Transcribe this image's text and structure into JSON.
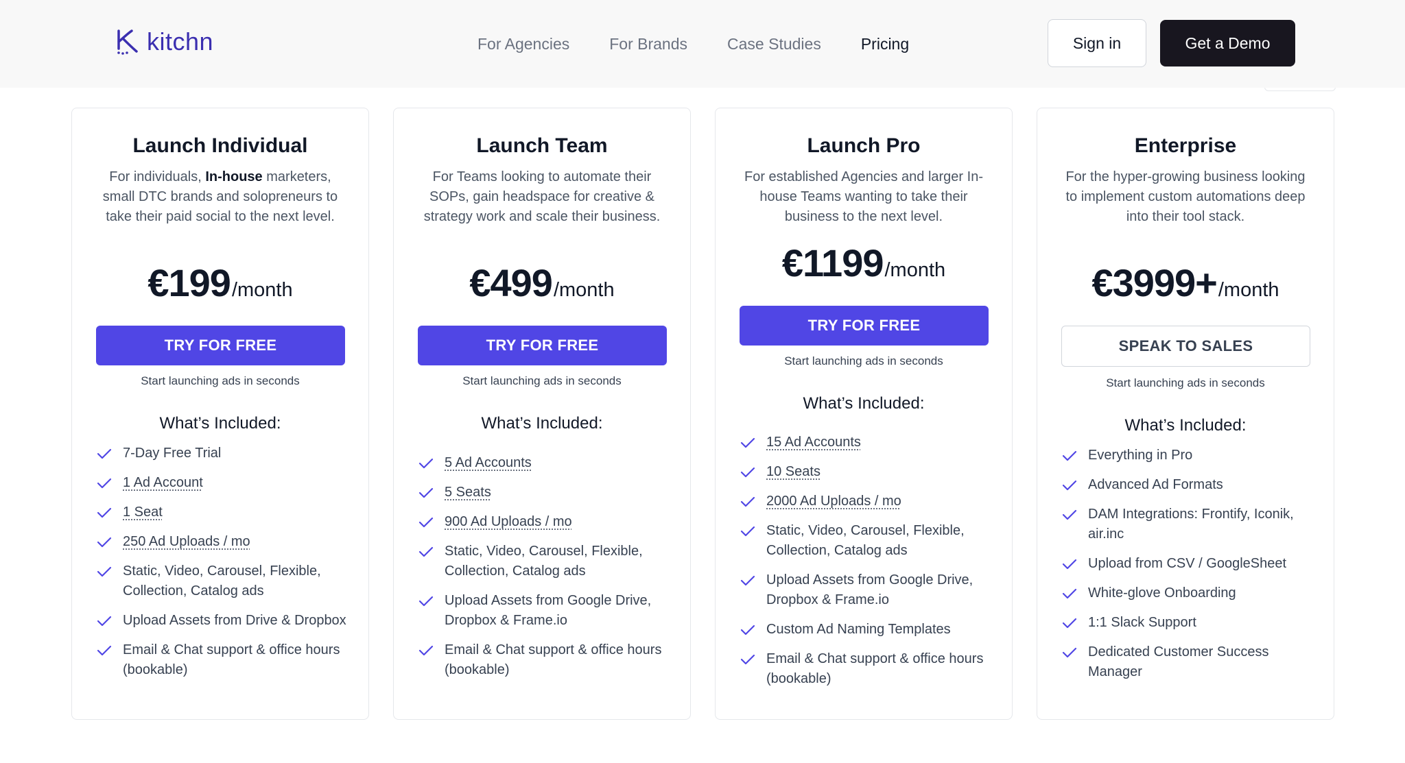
{
  "header": {
    "logo_text": "kitchn",
    "nav": [
      "For Agencies",
      "For Brands",
      "Case Studies",
      "Pricing"
    ],
    "sign_in": "Sign in",
    "get_demo": "Get a Demo"
  },
  "colors": {
    "accent": "#5046e5",
    "dark_button": "#18161f",
    "logo": "#3b2fb0"
  },
  "plans": [
    {
      "title": "Launch Individual",
      "desc_before": "For individuals, ",
      "desc_bold": "In-house",
      "desc_after": " marketers, small DTC brands and solopreneurs to take their paid social to the next level.",
      "price": "€199",
      "per": "/month",
      "cta": "TRY FOR FREE",
      "sub": "Start launching ads in seconds",
      "included": "What’s Included:",
      "features": [
        {
          "text": "7-Day Free Trial",
          "underline": false
        },
        {
          "text": "1 Ad Account",
          "underline": true
        },
        {
          "text": "1 Seat",
          "underline": true
        },
        {
          "text": "250 Ad Uploads / mo",
          "underline": true
        },
        {
          "text": "Static, Video, Carousel, Flexible, Collection, Catalog ads",
          "underline": false
        },
        {
          "text": "Upload Assets from Drive & Dropbox",
          "underline": false
        },
        {
          "text": "Email & Chat support & office hours (bookable)",
          "underline": false
        }
      ]
    },
    {
      "title": "Launch Team",
      "desc_before": "For Teams looking to automate their SOPs, gain headspace for creative & strategy work and scale their business.",
      "desc_bold": "",
      "desc_after": "",
      "price": "€499",
      "per": "/month",
      "cta": "TRY FOR FREE",
      "sub": "Start launching ads in seconds",
      "included": "What’s Included:",
      "features": [
        {
          "text": "5 Ad Accounts",
          "underline": true
        },
        {
          "text": "5 Seats",
          "underline": true
        },
        {
          "text": "900 Ad Uploads / mo",
          "underline": true
        },
        {
          "text": "Static, Video, Carousel, Flexible, Collection, Catalog ads",
          "underline": false
        },
        {
          "text": "Upload Assets from Google Drive, Dropbox & Frame.io",
          "underline": false
        },
        {
          "text": "Email & Chat support & office hours (bookable)",
          "underline": false
        }
      ]
    },
    {
      "title": "Launch Pro",
      "desc_before": "For established Agencies and larger In-house Teams wanting to take their business to the next level.",
      "desc_bold": "",
      "desc_after": "",
      "price": "€1199",
      "per": "/month",
      "cta": "TRY FOR FREE",
      "sub": "Start launching ads in seconds",
      "included": "What’s Included:",
      "features": [
        {
          "text": "15 Ad Accounts",
          "underline": true
        },
        {
          "text": "10 Seats",
          "underline": true
        },
        {
          "text": "2000 Ad Uploads / mo",
          "underline": true
        },
        {
          "text": "Static, Video, Carousel, Flexible, Collection, Catalog ads",
          "underline": false
        },
        {
          "text": "Upload Assets from Google Drive, Dropbox & Frame.io",
          "underline": false
        },
        {
          "text": "Custom Ad Naming Templates",
          "underline": false
        },
        {
          "text": "Email & Chat support & office hours (bookable)",
          "underline": false
        }
      ]
    },
    {
      "title": "Enterprise",
      "desc_before": "For the hyper-growing business looking to implement custom automations deep into their tool stack.",
      "desc_bold": "",
      "desc_after": "",
      "price": "€3999+",
      "per": "/month",
      "cta": "SPEAK TO SALES",
      "sub": "Start launching ads in seconds",
      "included": "What’s Included:",
      "features": [
        {
          "text": "Everything in Pro",
          "underline": false
        },
        {
          "text": "Advanced Ad Formats",
          "underline": false
        },
        {
          "text": "DAM Integrations: Frontify, Iconik, air.inc",
          "underline": false
        },
        {
          "text": "Upload from CSV / GoogleSheet",
          "underline": false
        },
        {
          "text": "White-glove Onboarding",
          "underline": false
        },
        {
          "text": "1:1 Slack Support",
          "underline": false
        },
        {
          "text": "Dedicated Customer Success Manager",
          "underline": false
        }
      ]
    }
  ]
}
